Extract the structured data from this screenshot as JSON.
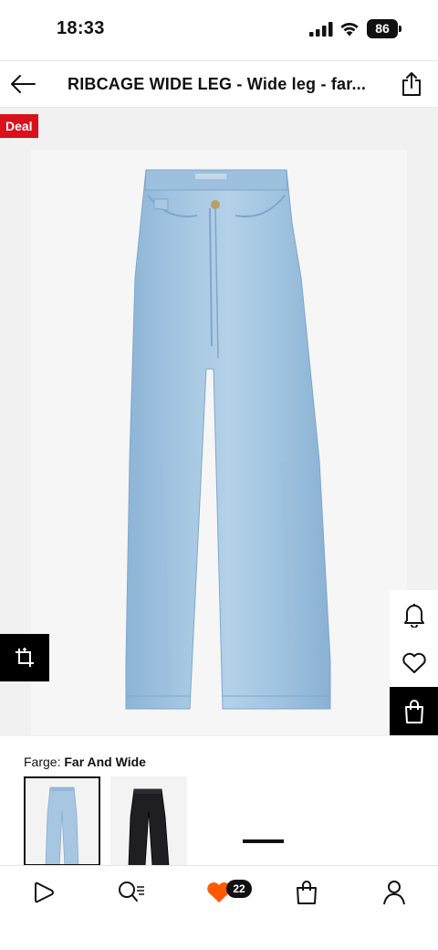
{
  "status_bar": {
    "time": "18:33",
    "battery": "86"
  },
  "header": {
    "title": "RIBCAGE WIDE LEG - Wide leg - far..."
  },
  "product": {
    "badge": "Deal"
  },
  "color": {
    "label": "Farge:",
    "value": "Far And Wide",
    "swatch_count": 2,
    "selected_index": 0
  },
  "bottom_nav": {
    "wishlist_count": "22"
  },
  "colors": {
    "deal_red": "#d9111d",
    "wishlist_orange": "#ff5a00",
    "denim_blue": "#9cc1df",
    "black": "#000000"
  },
  "icons": [
    "back-arrow-icon",
    "share-icon",
    "bell-icon",
    "heart-icon",
    "bag-icon",
    "crop-icon",
    "home-icon",
    "search-icon",
    "wishlist-heart-icon",
    "cart-icon",
    "profile-icon"
  ]
}
